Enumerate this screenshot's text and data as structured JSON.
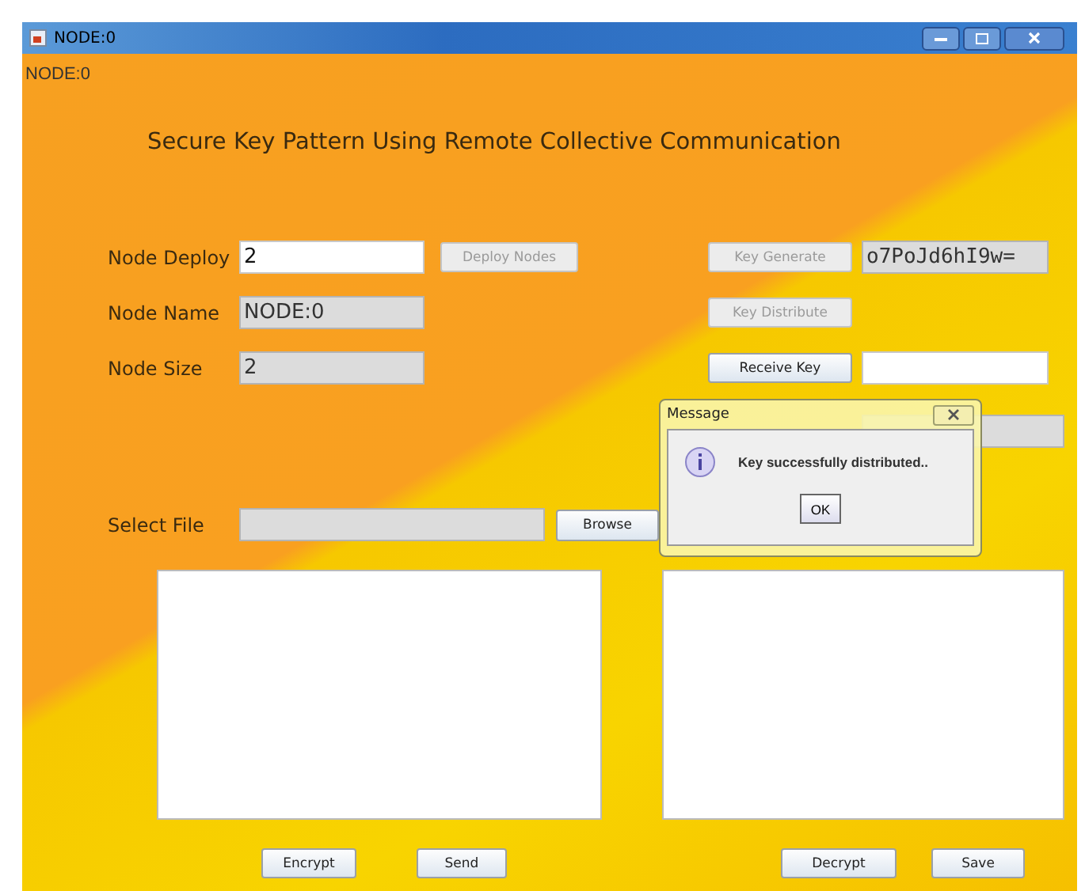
{
  "window": {
    "title": "NODE:0"
  },
  "node_label": "NODE:0",
  "heading": "Secure Key Pattern Using Remote Collective Communication",
  "left_rows": [
    {
      "label": "Node Deploy",
      "field": {
        "value": "2",
        "editable": true
      },
      "button": {
        "label": "Deploy Nodes",
        "disabled": true
      }
    },
    {
      "label": "Node Name",
      "field": {
        "value": "NODE:0",
        "editable": false
      }
    },
    {
      "label": "Node Size",
      "field": {
        "value": "2",
        "editable": false
      }
    }
  ],
  "right_rows": [
    {
      "button": {
        "label": "Key Generate",
        "disabled": true
      },
      "field": {
        "value": "o7PoJd6hI9w=",
        "editable": false
      }
    },
    {
      "button": {
        "label": "Key Distribute",
        "disabled": true
      }
    },
    {
      "button": {
        "label": "Receive Key",
        "disabled": false
      },
      "field": {
        "editable": true
      }
    },
    {
      "field": {
        "editable": false
      }
    }
  ],
  "select_file": {
    "label": "Select File",
    "button": "Browse"
  },
  "bottom_buttons": [
    {
      "label": "Encrypt"
    },
    {
      "label": "Send"
    },
    {
      "label": "Decrypt"
    },
    {
      "label": "Save"
    }
  ],
  "dialog": {
    "title": "Message",
    "message": "Key successfully distributed..",
    "button": "OK"
  }
}
